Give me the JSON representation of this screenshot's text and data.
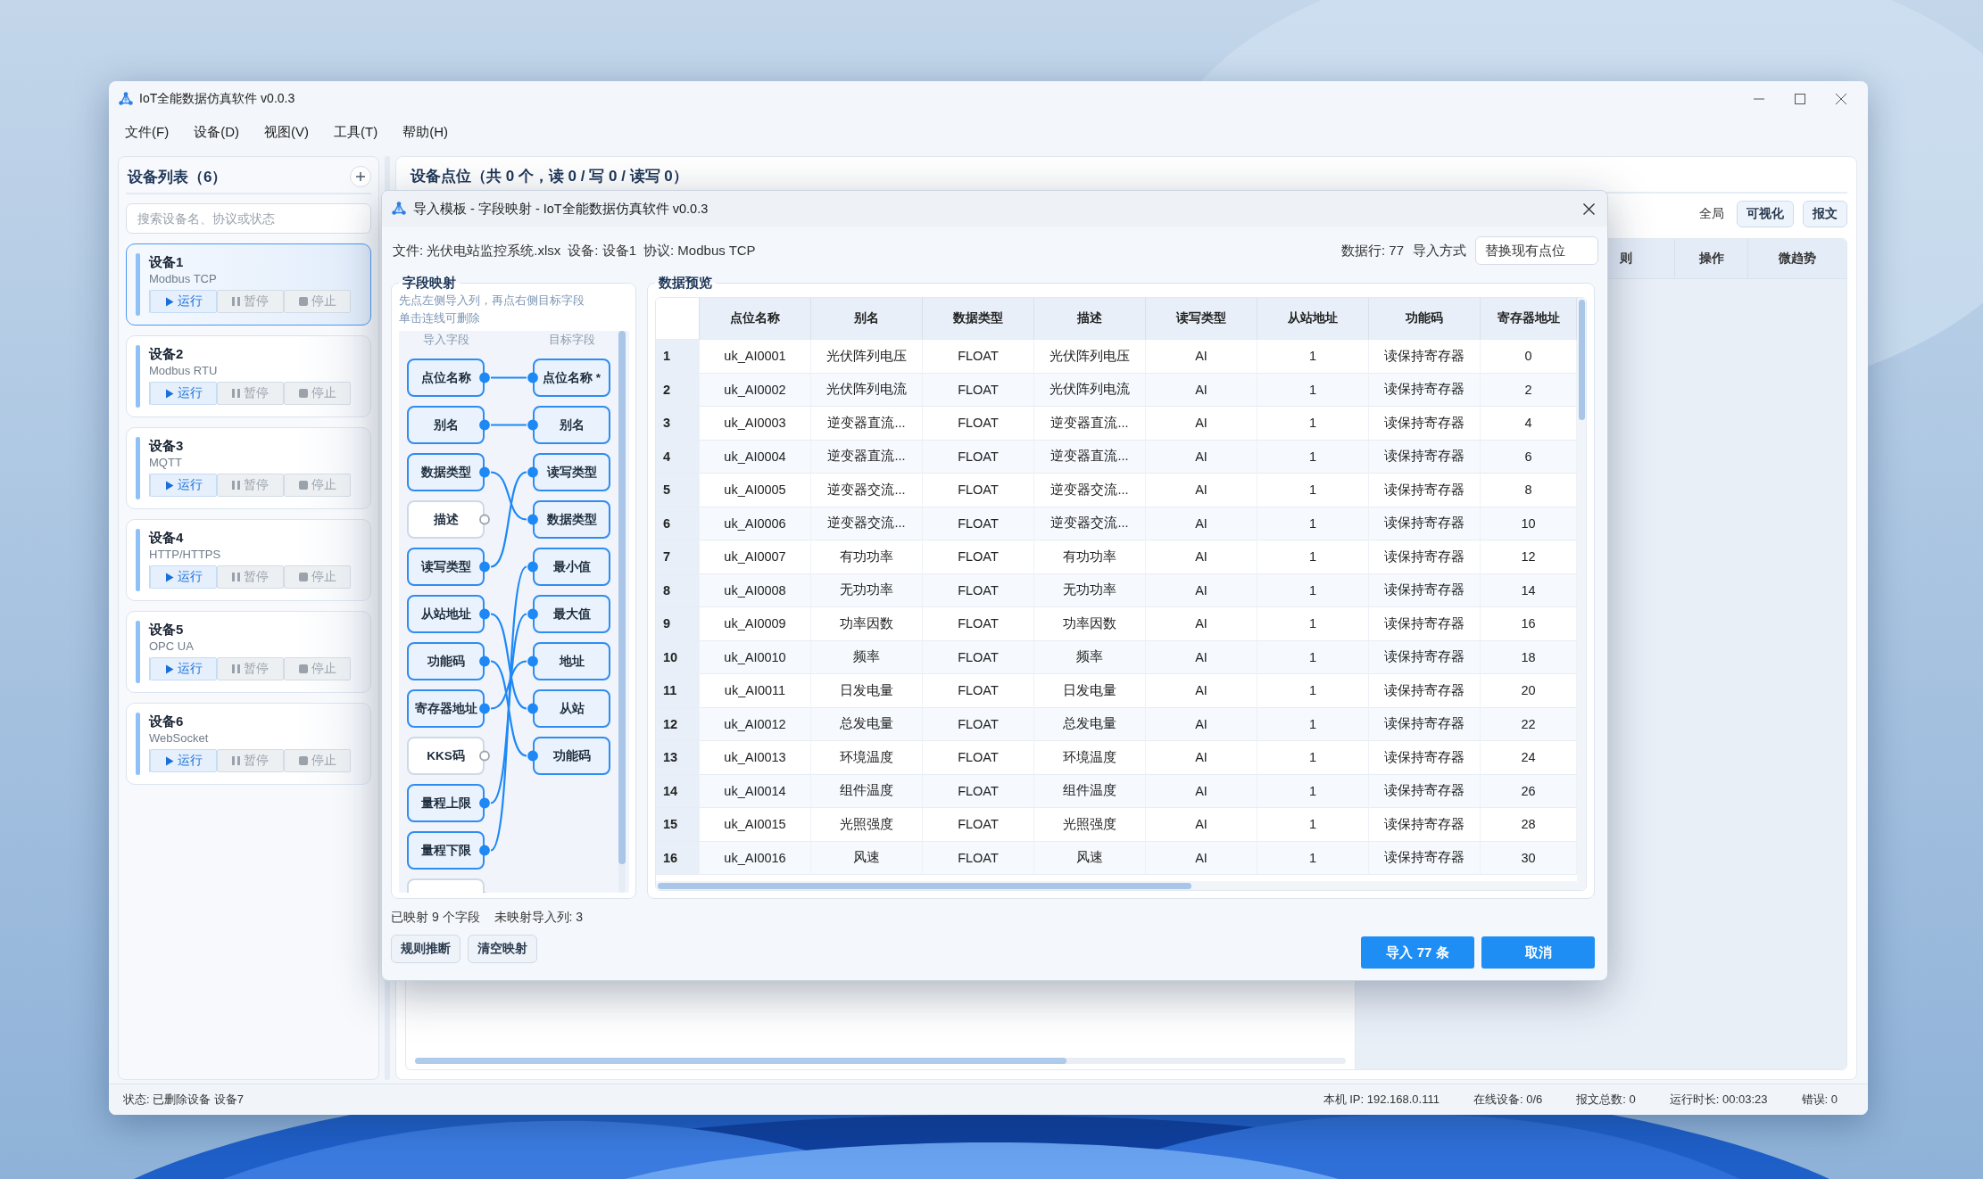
{
  "window": {
    "title": "IoT全能数据仿真软件 v0.0.3"
  },
  "menu": [
    "文件(F)",
    "设备(D)",
    "视图(V)",
    "工具(T)",
    "帮助(H)"
  ],
  "sidebar": {
    "title": "设备列表（6）",
    "search": {
      "placeholder": "搜索设备名、协议或状态"
    },
    "devices": [
      {
        "name": "设备1",
        "protocol": "Modbus TCP",
        "selected": true,
        "actions": [
          {
            "kind": "run",
            "label": "运行"
          },
          {
            "kind": "pause",
            "label": "暂停"
          },
          {
            "kind": "stop",
            "label": "停止"
          }
        ]
      },
      {
        "name": "设备2",
        "protocol": "Modbus RTU",
        "selected": false,
        "actions": [
          {
            "kind": "run",
            "label": "运行"
          },
          {
            "kind": "pause",
            "label": "暂停"
          },
          {
            "kind": "stop",
            "label": "停止"
          }
        ]
      },
      {
        "name": "设备3",
        "protocol": "MQTT",
        "selected": false,
        "actions": [
          {
            "kind": "run",
            "label": "运行"
          },
          {
            "kind": "pause",
            "label": "暂停"
          },
          {
            "kind": "stop",
            "label": "停止"
          }
        ]
      },
      {
        "name": "设备4",
        "protocol": "HTTP/HTTPS",
        "selected": false,
        "actions": [
          {
            "kind": "run",
            "label": "运行"
          },
          {
            "kind": "pause",
            "label": "暂停"
          },
          {
            "kind": "stop",
            "label": "停止"
          }
        ]
      },
      {
        "name": "设备5",
        "protocol": "OPC UA",
        "selected": false,
        "actions": [
          {
            "kind": "run",
            "label": "运行"
          },
          {
            "kind": "pause",
            "label": "暂停"
          },
          {
            "kind": "stop",
            "label": "停止"
          }
        ]
      },
      {
        "name": "设备6",
        "protocol": "WebSocket",
        "selected": false,
        "actions": [
          {
            "kind": "run",
            "label": "运行"
          },
          {
            "kind": "pause",
            "label": "暂停"
          },
          {
            "kind": "stop",
            "label": "停止"
          }
        ]
      }
    ]
  },
  "main": {
    "title": "设备点位（共 0 个，读 0 / 写 0 / 读写 0）",
    "toolbar": [
      {
        "kind": "text",
        "label": "全局"
      },
      {
        "kind": "button",
        "label": "可视化"
      },
      {
        "kind": "button",
        "label": "报文"
      }
    ],
    "columns": [
      "则",
      "操作",
      "微趋势"
    ]
  },
  "dialog": {
    "title": "导入模板 - 字段映射 - IoT全能数据仿真软件 v0.0.3",
    "file_info": [
      "文件: 光伏电站监控系统.xlsx",
      "设备: 设备1",
      "协议: Modbus TCP"
    ],
    "row_count": "数据行: 77",
    "import_mode_label": "导入方式",
    "import_mode": "替换现有点位",
    "mapping": {
      "title": "字段映射",
      "hints": [
        "先点左侧导入列，再点右侧目标字段",
        "单击连线可删除"
      ],
      "source_header": "导入字段",
      "target_header": "目标字段",
      "sources": [
        {
          "label": "点位名称",
          "mapped": true,
          "kind": "first"
        },
        {
          "label": "别名",
          "mapped": true,
          "kind": "second"
        },
        {
          "label": "数据类型",
          "mapped": true,
          "kind": "fourth"
        },
        {
          "label": "描述",
          "mapped": false,
          "kind": "none"
        },
        {
          "label": "读写类型",
          "mapped": true,
          "kind": "third"
        },
        {
          "label": "从站地址",
          "mapped": true,
          "kind": "eighth"
        },
        {
          "label": "功能码",
          "mapped": true,
          "kind": "ninth"
        },
        {
          "label": "寄存器地址",
          "mapped": true,
          "kind": "seventh"
        },
        {
          "label": "KKS码",
          "mapped": false,
          "kind": "none"
        },
        {
          "label": "量程上限",
          "mapped": true,
          "kind": "sixth"
        },
        {
          "label": "量程下限",
          "mapped": true,
          "kind": "fifth"
        },
        {
          "mapped": false,
          "kind": "none"
        }
      ],
      "targets": [
        {
          "label": "点位名称 *",
          "mapped": true
        },
        {
          "label": "别名",
          "mapped": true
        },
        {
          "label": "读写类型",
          "mapped": true
        },
        {
          "label": "数据类型",
          "mapped": true
        },
        {
          "label": "最小值",
          "mapped": true
        },
        {
          "label": "最大值",
          "mapped": true
        },
        {
          "label": "地址",
          "mapped": true
        },
        {
          "label": "从站",
          "mapped": true
        },
        {
          "label": "功能码",
          "mapped": true
        }
      ]
    },
    "preview": {
      "title": "数据预览",
      "columns": [
        "点位名称",
        "别名",
        "数据类型",
        "描述",
        "读写类型",
        "从站地址",
        "功能码",
        "寄存器地址"
      ],
      "rows": [
        {
          "index": "1",
          "cells": [
            "uk_AI0001",
            "光伏阵列电压",
            "FLOAT",
            "光伏阵列电压",
            "AI",
            "1",
            "读保持寄存器",
            "0"
          ]
        },
        {
          "index": "2",
          "cells": [
            "uk_AI0002",
            "光伏阵列电流",
            "FLOAT",
            "光伏阵列电流",
            "AI",
            "1",
            "读保持寄存器",
            "2"
          ]
        },
        {
          "index": "3",
          "cells": [
            "uk_AI0003",
            "逆变器直流...",
            "FLOAT",
            "逆变器直流...",
            "AI",
            "1",
            "读保持寄存器",
            "4"
          ]
        },
        {
          "index": "4",
          "cells": [
            "uk_AI0004",
            "逆变器直流...",
            "FLOAT",
            "逆变器直流...",
            "AI",
            "1",
            "读保持寄存器",
            "6"
          ]
        },
        {
          "index": "5",
          "cells": [
            "uk_AI0005",
            "逆变器交流...",
            "FLOAT",
            "逆变器交流...",
            "AI",
            "1",
            "读保持寄存器",
            "8"
          ]
        },
        {
          "index": "6",
          "cells": [
            "uk_AI0006",
            "逆变器交流...",
            "FLOAT",
            "逆变器交流...",
            "AI",
            "1",
            "读保持寄存器",
            "10"
          ]
        },
        {
          "index": "7",
          "cells": [
            "uk_AI0007",
            "有功功率",
            "FLOAT",
            "有功功率",
            "AI",
            "1",
            "读保持寄存器",
            "12"
          ]
        },
        {
          "index": "8",
          "cells": [
            "uk_AI0008",
            "无功功率",
            "FLOAT",
            "无功功率",
            "AI",
            "1",
            "读保持寄存器",
            "14"
          ]
        },
        {
          "index": "9",
          "cells": [
            "uk_AI0009",
            "功率因数",
            "FLOAT",
            "功率因数",
            "AI",
            "1",
            "读保持寄存器",
            "16"
          ]
        },
        {
          "index": "10",
          "cells": [
            "uk_AI0010",
            "频率",
            "FLOAT",
            "频率",
            "AI",
            "1",
            "读保持寄存器",
            "18"
          ]
        },
        {
          "index": "11",
          "cells": [
            "uk_AI0011",
            "日发电量",
            "FLOAT",
            "日发电量",
            "AI",
            "1",
            "读保持寄存器",
            "20"
          ]
        },
        {
          "index": "12",
          "cells": [
            "uk_AI0012",
            "总发电量",
            "FLOAT",
            "总发电量",
            "AI",
            "1",
            "读保持寄存器",
            "22"
          ]
        },
        {
          "index": "13",
          "cells": [
            "uk_AI0013",
            "环境温度",
            "FLOAT",
            "环境温度",
            "AI",
            "1",
            "读保持寄存器",
            "24"
          ]
        },
        {
          "index": "14",
          "cells": [
            "uk_AI0014",
            "组件温度",
            "FLOAT",
            "组件温度",
            "AI",
            "1",
            "读保持寄存器",
            "26"
          ]
        },
        {
          "index": "15",
          "cells": [
            "uk_AI0015",
            "光照强度",
            "FLOAT",
            "光照强度",
            "AI",
            "1",
            "读保持寄存器",
            "28"
          ]
        },
        {
          "index": "16",
          "cells": [
            "uk_AI0016",
            "风速",
            "FLOAT",
            "风速",
            "AI",
            "1",
            "读保持寄存器",
            "30"
          ]
        }
      ]
    },
    "summary": [
      "已映射 9 个字段",
      "未映射导入列: 3"
    ],
    "buttons": [
      {
        "kind": "secondary",
        "label": "规则推断"
      },
      {
        "kind": "secondary",
        "label": "清空映射"
      },
      {
        "kind": "primary",
        "label": "导入 77 条"
      },
      {
        "kind": "primary",
        "label": "取消"
      }
    ]
  },
  "status_bar": {
    "left": "状态: 已删除设备 设备7",
    "items": [
      "本机 IP: 192.168.0.111",
      "在线设备: 0/6",
      "报文总数: 0",
      "运行时长: 00:03:23",
      "错误: 0"
    ]
  }
}
